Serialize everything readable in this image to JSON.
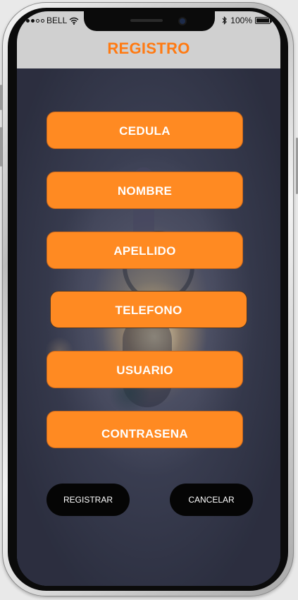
{
  "status_bar": {
    "carrier": "BELL",
    "battery_percent": "100%",
    "icons": [
      "signal-dots-icon",
      "wifi-icon",
      "bluetooth-icon",
      "battery-icon"
    ]
  },
  "header": {
    "title": "REGISTRO",
    "title_color": "#ff7a12"
  },
  "form": {
    "fields": [
      {
        "label": "CEDULA"
      },
      {
        "label": "NOMBRE"
      },
      {
        "label": "APELLIDO"
      },
      {
        "label": "TELEFONO"
      },
      {
        "label": "USUARIO"
      },
      {
        "label": "CONTRASENA"
      }
    ],
    "field_color": "#ff8a22"
  },
  "actions": {
    "register_label": "REGISTRAR",
    "cancel_label": "CANCELAR"
  }
}
